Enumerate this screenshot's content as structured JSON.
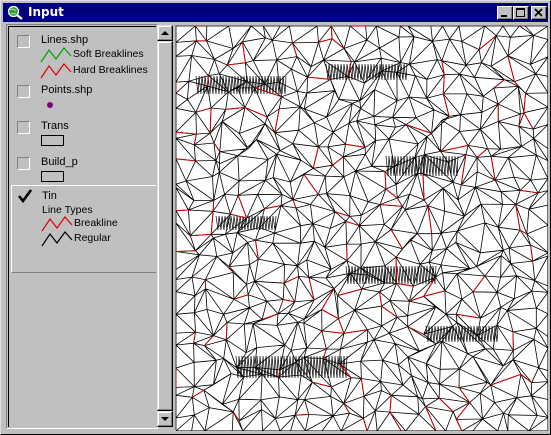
{
  "window": {
    "title": "Input"
  },
  "layers": [
    {
      "name": "Lines.shp",
      "checked": false,
      "legend": [
        {
          "label": "Soft Breaklines",
          "color": "#00a000"
        },
        {
          "label": "Hard Breaklines",
          "color": "#e00000"
        }
      ]
    },
    {
      "name": "Points.shp",
      "checked": false,
      "point_color": "#800080"
    },
    {
      "name": "Trans",
      "checked": false
    },
    {
      "name": "Build_p",
      "checked": false
    },
    {
      "name": "Tin",
      "checked": true,
      "subtitle": "Line Types",
      "legend": [
        {
          "label": "Breakline",
          "color": "#e00000"
        },
        {
          "label": "Regular",
          "color": "#000000"
        }
      ]
    }
  ],
  "colors": {
    "titlebar": "#000080",
    "tin_regular": "#000000",
    "tin_breakline": "#cc0000",
    "map_background": "#ffffff"
  },
  "icons": {
    "app": "globe-magnifier-icon",
    "minimize": "minimize-icon",
    "maximize": "maximize-icon",
    "close": "close-icon",
    "check": "checkmark-icon"
  }
}
